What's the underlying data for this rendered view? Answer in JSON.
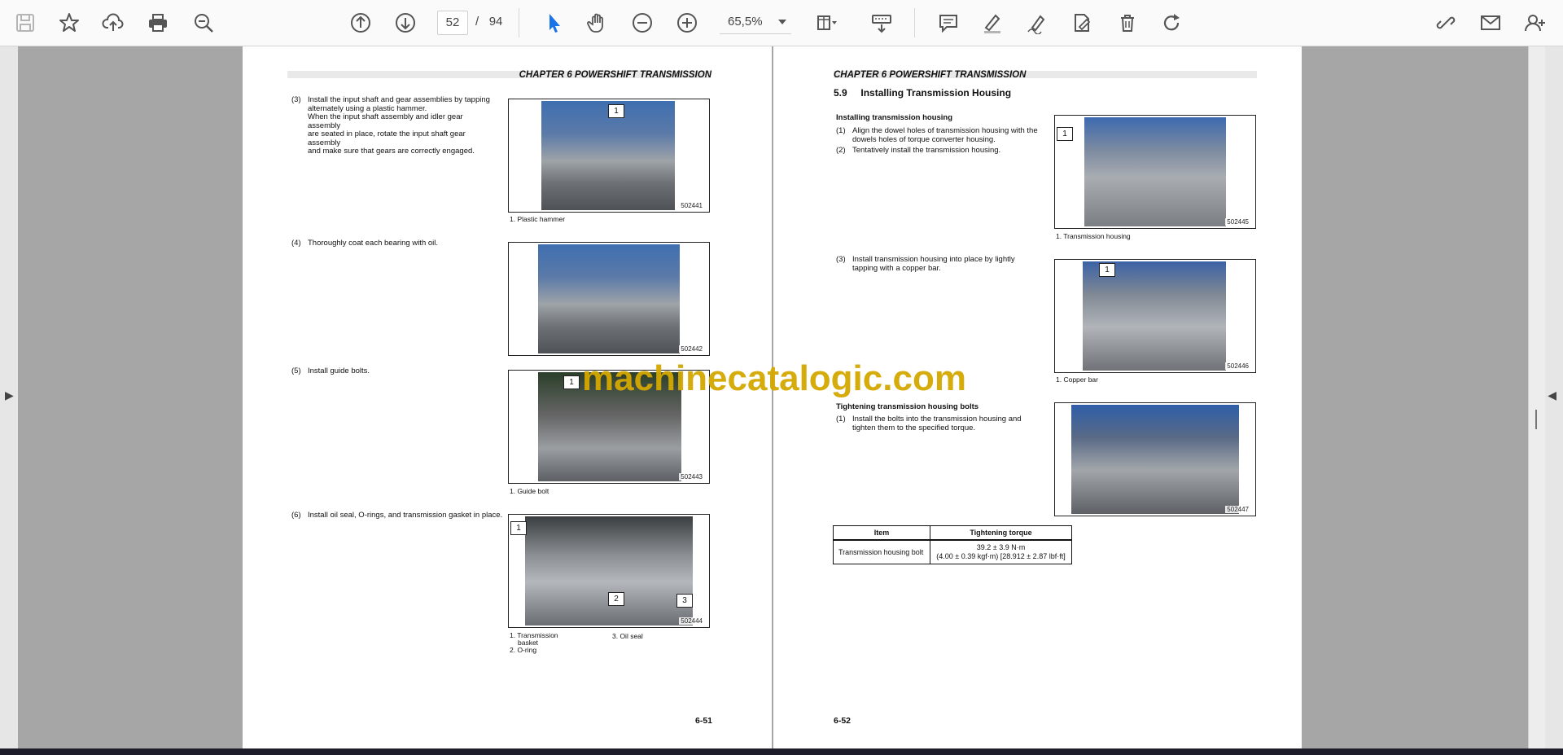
{
  "toolbar": {
    "page_current": "52",
    "page_separator": "/",
    "page_total": "94",
    "zoom": "65,5%"
  },
  "left_page": {
    "chapter": "CHAPTER 6 POWERSHIFT TRANSMISSION",
    "steps": [
      {
        "num": "(3)",
        "lines": [
          "Install the input shaft and gear assemblies by tapping",
          "alternately using a plastic hammer.",
          "When the input shaft assembly and idler gear assembly",
          "are seated in place, rotate the input shaft gear assembly",
          "and make sure that gears are correctly engaged."
        ]
      },
      {
        "num": "(4)",
        "lines": [
          "Thoroughly coat each bearing with oil."
        ]
      },
      {
        "num": "(5)",
        "lines": [
          "Install guide bolts."
        ]
      },
      {
        "num": "(6)",
        "lines": [
          "Install oil seal, O-rings, and transmission gasket in place."
        ]
      }
    ],
    "photos": [
      {
        "code": "502441",
        "caption": "1. Plastic hammer",
        "callouts": [
          "1"
        ]
      },
      {
        "code": "502442"
      },
      {
        "code": "502443",
        "caption": "1. Guide bolt",
        "callouts": [
          "1"
        ]
      },
      {
        "code": "502444",
        "callouts": [
          "1",
          "2",
          "3"
        ],
        "captions": [
          "1. Transmission",
          "basket",
          "2. O-ring",
          "3. Oil seal"
        ]
      }
    ],
    "page_number": "6-51"
  },
  "right_page": {
    "chapter": "CHAPTER 6 POWERSHIFT TRANSMISSION",
    "section_number": "5.9",
    "section_title": "Installing Transmission Housing",
    "sub1": "Installing transmission housing",
    "sub1_steps": [
      {
        "num": "(1)",
        "lines": [
          "Align the dowel holes of transmission housing with the",
          "dowels holes of torque converter housing."
        ]
      },
      {
        "num": "(2)",
        "lines": [
          "Tentatively install the transmission housing."
        ]
      },
      {
        "num": "(3)",
        "lines": [
          "Install transmission housing into place by lightly",
          "tapping with a copper bar."
        ]
      }
    ],
    "sub2": "Tightening transmission housing bolts",
    "sub2_steps": [
      {
        "num": "(1)",
        "lines": [
          "Install the bolts into the transmission housing and",
          "tighten them to the specified torque."
        ]
      }
    ],
    "photos": [
      {
        "code": "502445",
        "caption": "1. Transmission housing",
        "callouts": [
          "1"
        ]
      },
      {
        "code": "502446",
        "caption": "1. Copper bar",
        "callouts": [
          "1"
        ]
      },
      {
        "code": "502447"
      }
    ],
    "table": {
      "headers": [
        "Item",
        "Tightening torque"
      ],
      "row": {
        "item": "Transmission housing bolt",
        "torque_1": "39.2 ± 3.9 N·m",
        "torque_2": "(4.00 ± 0.39 kgf·m) [28.912 ± 2.87 lbf·ft]"
      }
    },
    "page_number": "6-52"
  },
  "watermark": "machinecatalogic.com",
  "colors": {
    "accent_blue": "#1a73e8",
    "watermark": "#d4a800"
  }
}
